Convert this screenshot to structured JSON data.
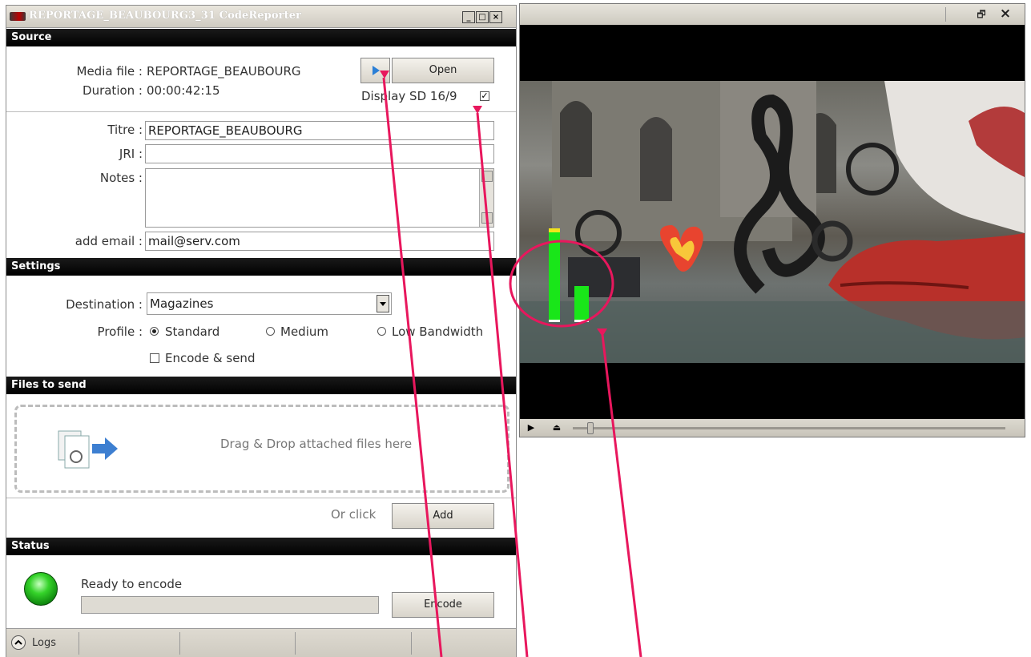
{
  "window": {
    "title": "REPORTAGE_BEAUBOURG3_31 CodeReporter",
    "min_label": "_",
    "max_label": "□",
    "close_label": "×"
  },
  "sections": {
    "source": "Source",
    "settings": "Settings",
    "files": "Files to send",
    "status": "Status"
  },
  "source": {
    "media_file_label": "Media file :",
    "media_file_value": "REPORTAGE_BEAUBOURG",
    "duration_label": "Duration :",
    "duration_value": "00:00:42:15",
    "open_button": "Open",
    "display_sd_label": "Display SD 16/9",
    "display_sd_checked": true,
    "titre_label": "Titre :",
    "titre_value": "REPORTAGE_BEAUBOURG",
    "jri_label": "JRI :",
    "jri_value": "",
    "notes_label": "Notes :",
    "notes_value": "",
    "email_label": "add email :",
    "email_value": "mail@serv.com"
  },
  "settings": {
    "destination_label": "Destination :",
    "destination_value": "Magazines",
    "profile_label": "Profile :",
    "profiles": [
      "Standard",
      "Medium",
      "Low Bandwidth"
    ],
    "profile_selected": "Standard",
    "encode_send_label": "Encode & send",
    "encode_send_checked": false
  },
  "files": {
    "drop_text": "Drag & Drop attached files here",
    "or_click": "Or click",
    "add_button": "Add"
  },
  "status": {
    "text": "Ready to encode",
    "progress": 0,
    "encode_button": "Encode",
    "light_color": "#2ecc2a"
  },
  "statusbar": {
    "logs_label": "Logs"
  },
  "player": {
    "restore_label": "🗗",
    "close_label": "×",
    "play_icon": "▶",
    "eject_icon": "⏏",
    "audio_level_left": 0.78,
    "audio_level_right": 0.3
  },
  "colors": {
    "annotation": "#e8175d",
    "vu_green": "#19e619",
    "vu_yellow": "#f2e41c"
  }
}
